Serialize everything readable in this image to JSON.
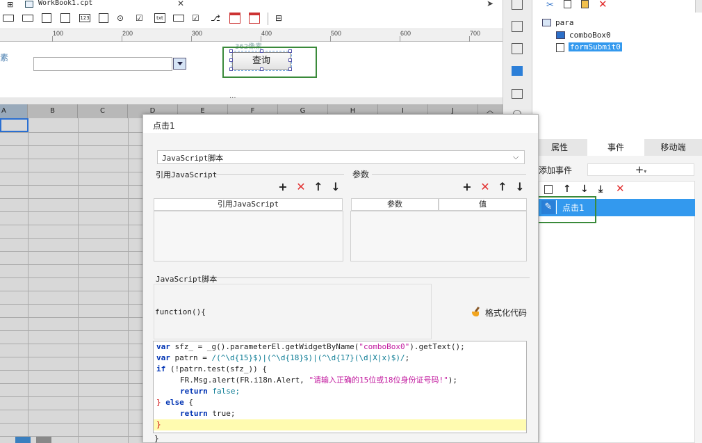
{
  "tab": {
    "title": "WorkBook1.cpt"
  },
  "ruler": {
    "labels": [
      "100",
      "200",
      "300",
      "400",
      "500",
      "600",
      "700"
    ]
  },
  "param": {
    "left_label": "素",
    "pixel_hint": "362像素",
    "query_button": "查询"
  },
  "grid": {
    "columns": [
      "A",
      "B",
      "C",
      "D",
      "E",
      "F",
      "G",
      "H",
      "I",
      "J"
    ]
  },
  "tree": {
    "root": "para",
    "items": [
      "comboBox0",
      "formSubmit0"
    ]
  },
  "tabs": {
    "attr": "属性",
    "event": "事件",
    "mobile": "移动端"
  },
  "events": {
    "add_label": "添加事件",
    "event_item": "点击1"
  },
  "dialog": {
    "title": "点击1",
    "type_select": "JavaScript脚本",
    "ref_js_label": "引用JavaScript",
    "params_label": "参数",
    "ref_col": "引用JavaScript",
    "param_col": "参数",
    "value_col": "值",
    "script_label": "JavaScript脚本",
    "function_open": "function(){",
    "format_label": "格式化代码",
    "function_close": "}"
  },
  "code": {
    "l1_kw": "var",
    "l1_a": " sfz_ = _g().parameterEl.getWidgetByName(",
    "l1_str": "\"comboBox0\"",
    "l1_b": ").getText();",
    "l2_kw": "var",
    "l2_a": " patrn = ",
    "l2_rx": "/(^\\d{15}$)|(^\\d{18}$)|(^\\d{17}(\\d|X|x)$)/",
    "l2_b": ";",
    "l3_kw": "if",
    "l3_a": " (!patrn.test(sfz_)) {",
    "l4_a": "FR.Msg.alert(FR.i18n.Alert, ",
    "l4_str": "\"请输入正确的15位或18位身份证号码!\"",
    "l4_b": ");",
    "l5_kw": "return",
    "l5_v": " false;",
    "l6_a": "} ",
    "l6_kw": "else",
    "l6_b": " {",
    "l7_kw": "return",
    "l7_v": " true;",
    "l8": "}"
  },
  "colors": {
    "accent": "#3399ee",
    "green": "#3a8a3a",
    "delete": "#e23030"
  }
}
